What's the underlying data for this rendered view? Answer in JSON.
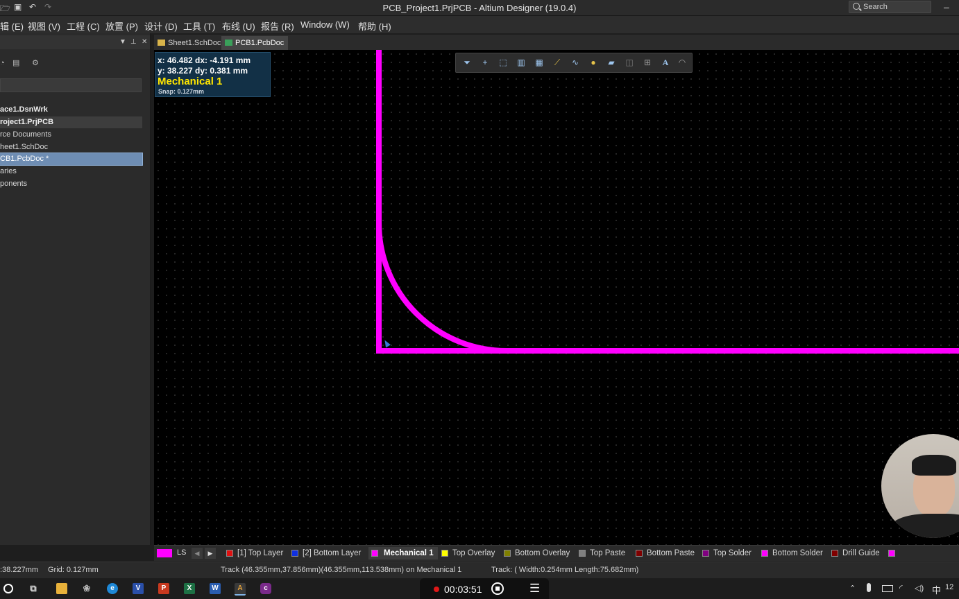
{
  "window": {
    "title": "PCB_Project1.PrjPCB - Altium Designer (19.0.4)",
    "search_placeholder": "Search",
    "minimize": "–"
  },
  "menu": [
    "辑 (E)",
    "视图 (V)",
    "工程 (C)",
    "放置 (P)",
    "设计 (D)",
    "工具 (T)",
    "布线 (U)",
    "报告 (R)",
    "Window (W)",
    "帮助 (H)"
  ],
  "panel": {
    "tree": [
      {
        "label": "ace1.DsnWrk",
        "style": "bold"
      },
      {
        "label": "roject1.PrjPCB",
        "style": "bold-active"
      },
      {
        "label": "rce Documents",
        "style": "normal"
      },
      {
        "label": "heet1.SchDoc",
        "style": "normal"
      },
      {
        "label": "CB1.PcbDoc *",
        "style": "selected"
      },
      {
        "label": "aries",
        "style": "normal"
      },
      {
        "label": "ponents",
        "style": "normal"
      },
      {
        "label": "",
        "style": "normal"
      }
    ]
  },
  "tabs": [
    {
      "label": "Sheet1.SchDoc",
      "active": false
    },
    {
      "label": "PCB1.PcbDoc *",
      "active": true
    }
  ],
  "hud": {
    "line1": "x: 46.482   dx: -4.191 mm",
    "line2": "y: 38.227   dy:  0.381 mm",
    "layer": "Mechanical 1",
    "snap": "Snap: 0.127mm"
  },
  "canvas_toolbar": [
    "filter-icon",
    "cross-icon",
    "select-rect-icon",
    "align-icon",
    "component-icon",
    "route-icon",
    "diff-pair-icon",
    "pad-icon",
    "polygon-icon",
    "keepout-icon",
    "dimension-icon",
    "text-icon",
    "arc-icon"
  ],
  "board": {
    "edge_color": "#ff00ff"
  },
  "layer_bar": {
    "ls_label": "LS",
    "current_swatch": "#ff00ff",
    "layers": [
      {
        "label": "[1] Top Layer",
        "color": "#e01010",
        "current": false
      },
      {
        "label": "[2] Bottom Layer",
        "color": "#1030e0",
        "current": false
      },
      {
        "label": "Mechanical 1",
        "color": "#ff00ff",
        "current": true
      },
      {
        "label": "Top Overlay",
        "color": "#ffff00",
        "current": false
      },
      {
        "label": "Bottom Overlay",
        "color": "#808000",
        "current": false
      },
      {
        "label": "Top Paste",
        "color": "#808080",
        "current": false
      },
      {
        "label": "Bottom Paste",
        "color": "#800000",
        "current": false
      },
      {
        "label": "Top Solder",
        "color": "#800080",
        "current": false
      },
      {
        "label": "Bottom Solder",
        "color": "#ff00ff",
        "current": false
      },
      {
        "label": "Drill Guide",
        "color": "#800000",
        "current": false
      }
    ]
  },
  "status": {
    "coords": ":38.227mm",
    "grid": "Grid: 0.127mm",
    "track_pos": "Track (46.355mm,37.856mm)(46.355mm,113.538mm) on Mechanical 1",
    "track_info": "Track: ( Width:0.254mm Length:75.682mm)"
  },
  "recorder": {
    "time": "00:03:51"
  },
  "tray": {
    "ime": "中",
    "clock": "12"
  }
}
